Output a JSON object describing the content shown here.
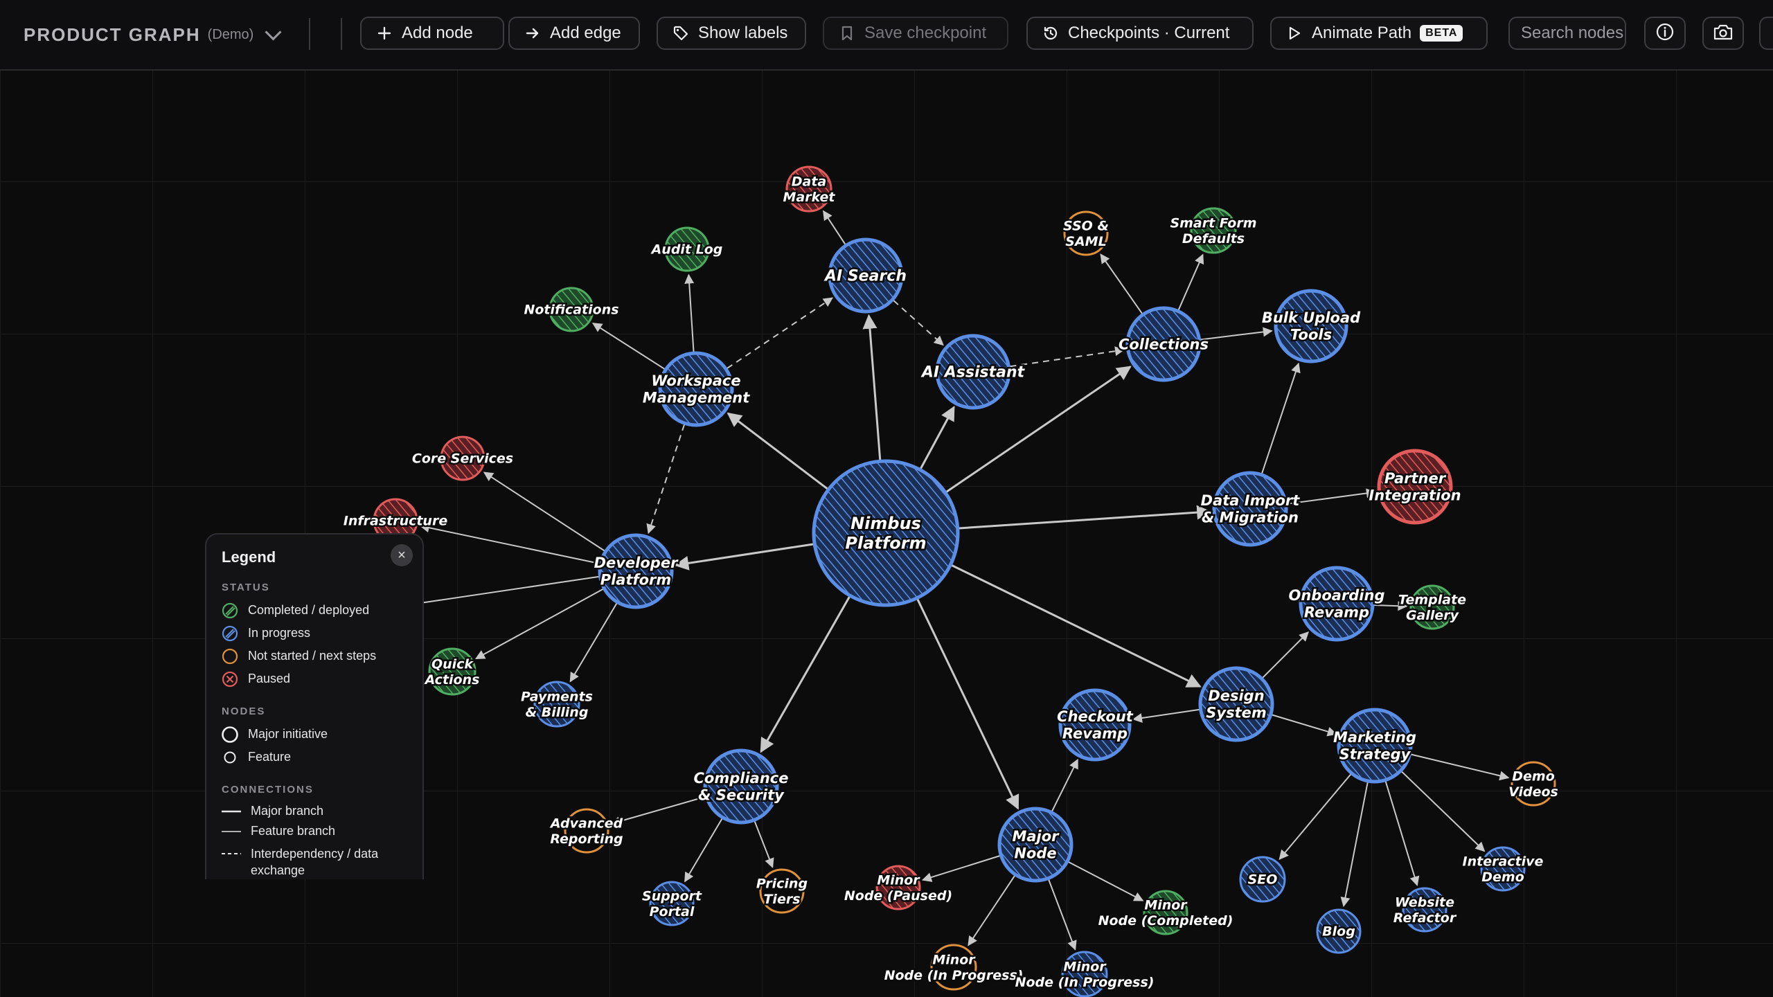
{
  "app": {
    "title": "PRODUCT GRAPH",
    "mode": "(Demo)"
  },
  "toolbar": {
    "add_node": "Add node",
    "add_edge": "Add edge",
    "show_labels": "Show labels",
    "save_checkpoint": "Save checkpoint",
    "checkpoints": "Checkpoints · Current",
    "animate_path": "Animate Path",
    "beta": "BETA",
    "search_placeholder": "Search nodes"
  },
  "colors": {
    "completed": "#4fae62",
    "in_progress": "#5b8fe6",
    "not_started": "#e0923a",
    "paused": "#e25c5c",
    "edge": "#c9c9c9"
  },
  "legend": {
    "title": "Legend",
    "status_heading": "STATUS",
    "completed": "Completed / deployed",
    "in_progress": "In progress",
    "not_started": "Not started / next steps",
    "paused": "Paused",
    "nodes_heading": "NODES",
    "major": "Major initiative",
    "feature": "Feature",
    "connections_heading": "CONNECTIONS",
    "major_branch": "Major branch",
    "feature_branch": "Feature branch",
    "interdependency": "Interdependency / data exchange"
  },
  "graph": {
    "nodes": [
      {
        "id": "nimbus",
        "label": [
          "Nimbus",
          "Platform"
        ],
        "status": "in_progress",
        "kind": "hub"
      },
      {
        "id": "ai_search",
        "label": [
          "AI Search"
        ],
        "status": "in_progress",
        "kind": "major"
      },
      {
        "id": "data_market",
        "label": [
          "Data",
          "Market"
        ],
        "status": "paused",
        "kind": "feature"
      },
      {
        "id": "ai_assistant",
        "label": [
          "AI Assistant"
        ],
        "status": "in_progress",
        "kind": "major"
      },
      {
        "id": "workspace",
        "label": [
          "Workspace",
          "Management"
        ],
        "status": "in_progress",
        "kind": "major"
      },
      {
        "id": "audit_log",
        "label": [
          "Audit Log"
        ],
        "status": "completed",
        "kind": "feature"
      },
      {
        "id": "notifications",
        "label": [
          "Notifications"
        ],
        "status": "completed",
        "kind": "feature"
      },
      {
        "id": "collections",
        "label": [
          "Collections"
        ],
        "status": "in_progress",
        "kind": "major"
      },
      {
        "id": "sso",
        "label": [
          "SSO &",
          "SAML"
        ],
        "status": "not_started",
        "kind": "feature"
      },
      {
        "id": "smart_form",
        "label": [
          "Smart Form",
          "Defaults"
        ],
        "status": "completed",
        "kind": "feature"
      },
      {
        "id": "bulk_upload",
        "label": [
          "Bulk Upload",
          "Tools"
        ],
        "status": "in_progress",
        "kind": "major"
      },
      {
        "id": "data_import",
        "label": [
          "Data Import",
          "& Migration"
        ],
        "status": "in_progress",
        "kind": "major"
      },
      {
        "id": "partner",
        "label": [
          "Partner",
          "Integration"
        ],
        "status": "paused",
        "kind": "major"
      },
      {
        "id": "developer",
        "label": [
          "Developer",
          "Platform"
        ],
        "status": "in_progress",
        "kind": "major"
      },
      {
        "id": "core_services",
        "label": [
          "Core Services"
        ],
        "status": "paused",
        "kind": "feature"
      },
      {
        "id": "infrastructure",
        "label": [
          "Infrastructure"
        ],
        "status": "paused",
        "kind": "feature"
      },
      {
        "id": "quick_actions",
        "label": [
          "Quick",
          "Actions"
        ],
        "status": "completed",
        "kind": "feature"
      },
      {
        "id": "payments",
        "label": [
          "Payments",
          "& Billing"
        ],
        "status": "in_progress",
        "kind": "feature"
      },
      {
        "id": "onboarding",
        "label": [
          "Onboarding",
          "Revamp"
        ],
        "status": "in_progress",
        "kind": "major"
      },
      {
        "id": "template",
        "label": [
          "Template",
          "Gallery"
        ],
        "status": "completed",
        "kind": "feature"
      },
      {
        "id": "design",
        "label": [
          "Design",
          "System"
        ],
        "status": "in_progress",
        "kind": "major"
      },
      {
        "id": "checkout",
        "label": [
          "Checkout",
          "Revamp"
        ],
        "status": "in_progress",
        "kind": "major"
      },
      {
        "id": "marketing",
        "label": [
          "Marketing",
          "Strategy"
        ],
        "status": "in_progress",
        "kind": "major"
      },
      {
        "id": "demo_videos",
        "label": [
          "Demo",
          "Videos"
        ],
        "status": "not_started",
        "kind": "feature"
      },
      {
        "id": "interactive_demo",
        "label": [
          "Interactive",
          "Demo"
        ],
        "status": "in_progress",
        "kind": "feature"
      },
      {
        "id": "website",
        "label": [
          "Website",
          "Refactor"
        ],
        "status": "in_progress",
        "kind": "feature"
      },
      {
        "id": "blog",
        "label": [
          "Blog"
        ],
        "status": "in_progress",
        "kind": "feature"
      },
      {
        "id": "seo",
        "label": [
          "SEO"
        ],
        "status": "in_progress",
        "kind": "feature"
      },
      {
        "id": "compliance",
        "label": [
          "Compliance",
          "& Security"
        ],
        "status": "in_progress",
        "kind": "major"
      },
      {
        "id": "advanced_reporting",
        "label": [
          "Advanced",
          "Reporting"
        ],
        "status": "not_started",
        "kind": "feature"
      },
      {
        "id": "support_portal",
        "label": [
          "Support",
          "Portal"
        ],
        "status": "in_progress",
        "kind": "feature"
      },
      {
        "id": "pricing",
        "label": [
          "Pricing",
          "Tiers"
        ],
        "status": "not_started",
        "kind": "feature"
      },
      {
        "id": "major_node",
        "label": [
          "Major",
          "Node"
        ],
        "status": "in_progress",
        "kind": "major"
      },
      {
        "id": "minor_paused",
        "label": [
          "Minor",
          "Node (Paused)"
        ],
        "status": "paused",
        "kind": "feature"
      },
      {
        "id": "minor_completed",
        "label": [
          "Minor",
          "Node (Completed)"
        ],
        "status": "completed",
        "kind": "feature"
      },
      {
        "id": "minor_ip1",
        "label": [
          "Minor",
          "Node (In Progress)"
        ],
        "status": "not_started",
        "kind": "feature"
      },
      {
        "id": "minor_ip2",
        "label": [
          "Minor",
          "Node (In Progress)"
        ],
        "status": "in_progress",
        "kind": "feature"
      }
    ],
    "edges": [
      {
        "from": "nimbus",
        "to": "ai_search",
        "style": "solid"
      },
      {
        "from": "nimbus",
        "to": "ai_assistant",
        "style": "solid"
      },
      {
        "from": "nimbus",
        "to": "workspace",
        "style": "solid"
      },
      {
        "from": "nimbus",
        "to": "collections",
        "style": "solid"
      },
      {
        "from": "nimbus",
        "to": "data_import",
        "style": "solid"
      },
      {
        "from": "nimbus",
        "to": "developer",
        "style": "solid"
      },
      {
        "from": "nimbus",
        "to": "design",
        "style": "solid"
      },
      {
        "from": "nimbus",
        "to": "major_node",
        "style": "solid"
      },
      {
        "from": "nimbus",
        "to": "compliance",
        "style": "solid"
      },
      {
        "from": "ai_search",
        "to": "data_market",
        "style": "solid"
      },
      {
        "from": "workspace",
        "to": "audit_log",
        "style": "solid"
      },
      {
        "from": "workspace",
        "to": "notifications",
        "style": "solid"
      },
      {
        "from": "workspace",
        "to": "ai_search",
        "style": "dashed"
      },
      {
        "from": "ai_search",
        "to": "ai_assistant",
        "style": "dashed"
      },
      {
        "from": "ai_assistant",
        "to": "collections",
        "style": "dashed"
      },
      {
        "from": "workspace",
        "to": "developer",
        "style": "dashed"
      },
      {
        "from": "collections",
        "to": "sso",
        "style": "solid"
      },
      {
        "from": "collections",
        "to": "smart_form",
        "style": "solid"
      },
      {
        "from": "collections",
        "to": "bulk_upload",
        "style": "solid"
      },
      {
        "from": "data_import",
        "to": "bulk_upload",
        "style": "solid"
      },
      {
        "from": "data_import",
        "to": "partner",
        "style": "solid"
      },
      {
        "from": "developer",
        "to": "core_services",
        "style": "solid"
      },
      {
        "from": "developer",
        "to": "infrastructure",
        "style": "solid"
      },
      {
        "from": "developer",
        "to": "quick_actions",
        "style": "solid"
      },
      {
        "from": "developer",
        "to": "payments",
        "style": "solid"
      },
      {
        "from": "developer",
        "to": "legend_hidden",
        "style": "solid"
      },
      {
        "from": "design",
        "to": "onboarding",
        "style": "solid"
      },
      {
        "from": "onboarding",
        "to": "template",
        "style": "solid"
      },
      {
        "from": "design",
        "to": "checkout",
        "style": "solid"
      },
      {
        "from": "design",
        "to": "marketing",
        "style": "solid"
      },
      {
        "from": "marketing",
        "to": "demo_videos",
        "style": "solid"
      },
      {
        "from": "marketing",
        "to": "interactive_demo",
        "style": "solid"
      },
      {
        "from": "marketing",
        "to": "website",
        "style": "solid"
      },
      {
        "from": "marketing",
        "to": "blog",
        "style": "solid"
      },
      {
        "from": "marketing",
        "to": "seo",
        "style": "solid"
      },
      {
        "from": "compliance",
        "to": "advanced_reporting",
        "style": "solid"
      },
      {
        "from": "compliance",
        "to": "support_portal",
        "style": "solid"
      },
      {
        "from": "compliance",
        "to": "pricing",
        "style": "solid"
      },
      {
        "from": "major_node",
        "to": "checkout",
        "style": "solid"
      },
      {
        "from": "major_node",
        "to": "minor_paused",
        "style": "solid"
      },
      {
        "from": "major_node",
        "to": "minor_completed",
        "style": "solid"
      },
      {
        "from": "major_node",
        "to": "minor_ip1",
        "style": "solid"
      },
      {
        "from": "major_node",
        "to": "minor_ip2",
        "style": "solid"
      }
    ]
  }
}
